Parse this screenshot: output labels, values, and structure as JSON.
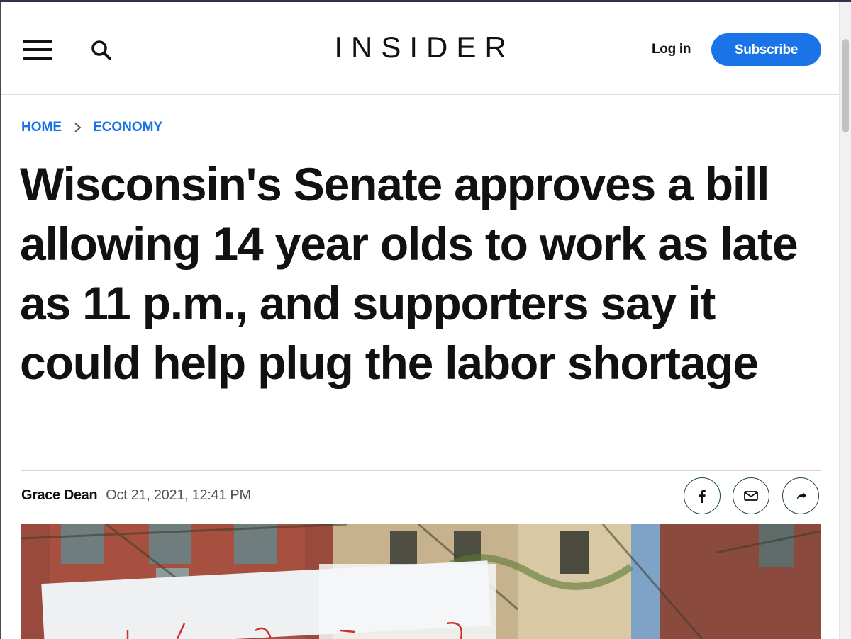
{
  "header": {
    "logo": "INSIDER",
    "login_label": "Log in",
    "subscribe_label": "Subscribe"
  },
  "breadcrumb": {
    "home": "HOME",
    "section": "ECONOMY"
  },
  "article": {
    "headline": "Wisconsin's Senate approves a bill allowing 14 year olds to work as late as 11 p.m., and supporters say it could help plug the labor shortage",
    "author": "Grace Dean",
    "date": "Oct 21, 2021, 12:41 PM"
  },
  "share": {
    "icons": [
      "facebook-icon",
      "email-icon",
      "share-icon"
    ]
  },
  "colors": {
    "accent": "#1a74e8",
    "text": "#111111",
    "muted": "#555555",
    "share_border": "#1c4a52"
  }
}
